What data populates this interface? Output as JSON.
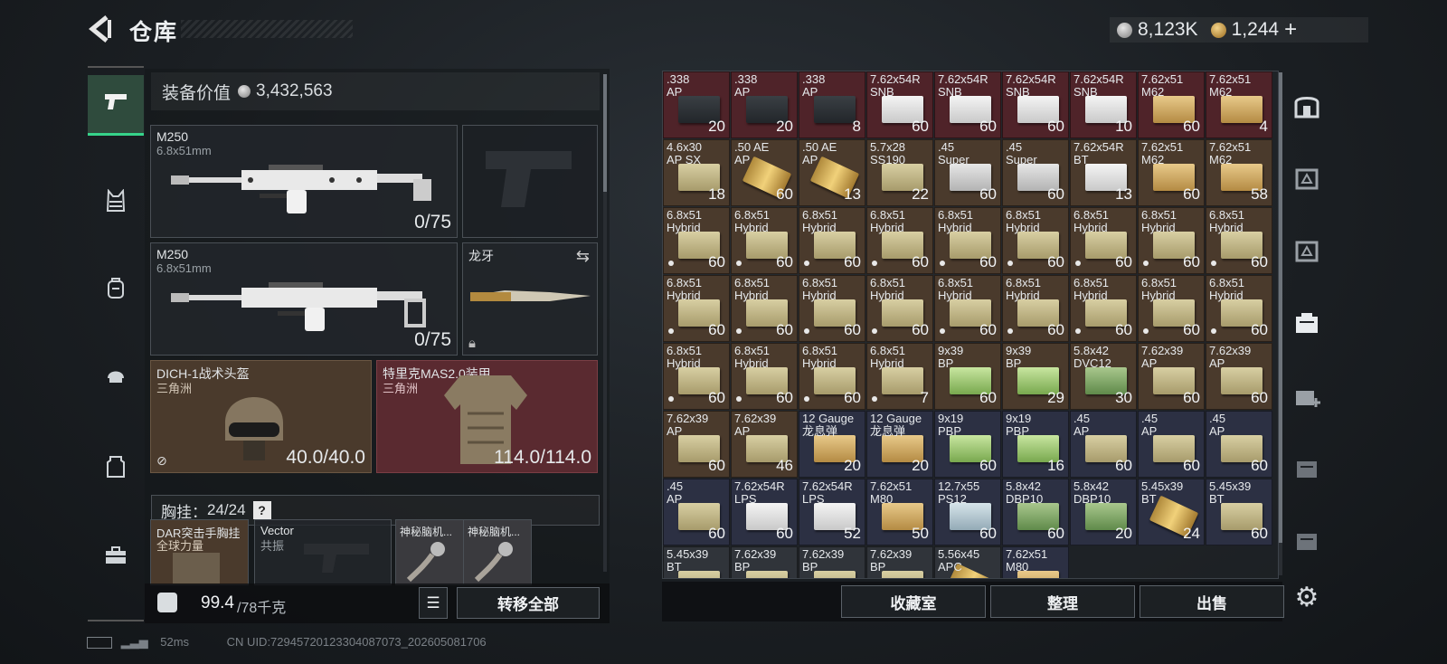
{
  "header": {
    "title": "仓库",
    "currency_silver": "8,123K",
    "currency_gold": "1,244",
    "add_symbol": "+"
  },
  "left_nav": [
    {
      "icon": "pistol-icon",
      "active": true
    },
    {
      "icon": "chest-rig-icon"
    },
    {
      "icon": "backpack-icon"
    },
    {
      "icon": "helmet-icon"
    },
    {
      "icon": "armor-plate-icon"
    },
    {
      "icon": "toolbox-icon"
    }
  ],
  "equipment": {
    "value_label": "装备价值",
    "value": "3,432,563",
    "primary": {
      "name": "M250",
      "caliber": "6.8x51mm",
      "ammo": "0/75"
    },
    "secondary": {
      "name": "M250",
      "caliber": "6.8x51mm",
      "ammo": "0/75"
    },
    "melee": {
      "name": "龙牙"
    },
    "helmet": {
      "name": "DICH-1战术头盔",
      "sub": "三角洲",
      "durability": "40.0/40.0"
    },
    "armor": {
      "name": "特里克MAS2.0装甲",
      "sub": "三角洲",
      "durability": "114.0/114.0"
    },
    "chest_rig": {
      "label": "胸挂：",
      "capacity": "24/24",
      "help": "?"
    },
    "rig_items": [
      {
        "name": "DAR突击手胸挂",
        "sub": "全球力量"
      },
      {
        "name": "Vector",
        "sub": "共振"
      },
      {
        "name": "神秘脑机..."
      },
      {
        "name": "神秘脑机..."
      }
    ],
    "weight": "99.4",
    "weight_max": "/78千克",
    "transfer_all": "转移全部"
  },
  "grid_items": [
    {
      "n": ".338",
      "s": "AP",
      "q": "20",
      "bg": "red",
      "box": "dark"
    },
    {
      "n": ".338",
      "s": "AP",
      "q": "20",
      "bg": "red",
      "box": "dark"
    },
    {
      "n": ".338",
      "s": "AP",
      "q": "8",
      "bg": "red",
      "box": "dark"
    },
    {
      "n": "7.62x54R",
      "s": "SNB",
      "q": "60",
      "bg": "red",
      "box": "white"
    },
    {
      "n": "7.62x54R",
      "s": "SNB",
      "q": "60",
      "bg": "red",
      "box": "white"
    },
    {
      "n": "7.62x54R",
      "s": "SNB",
      "q": "60",
      "bg": "red",
      "box": "white"
    },
    {
      "n": "7.62x54R",
      "s": "SNB",
      "q": "10",
      "bg": "red",
      "box": "white"
    },
    {
      "n": "7.62x51",
      "s": "M62",
      "q": "60",
      "bg": "red",
      "box": "gold"
    },
    {
      "n": "7.62x51",
      "s": "M62",
      "q": "4",
      "bg": "red",
      "box": "gold"
    },
    {
      "n": "4.6x30",
      "s": "AP SX",
      "q": "18",
      "bg": "brown",
      "box": "khaki"
    },
    {
      "n": ".50 AE",
      "s": "AP",
      "q": "60",
      "bg": "brown",
      "box": "bullet"
    },
    {
      "n": ".50 AE",
      "s": "AP",
      "q": "13",
      "bg": "brown",
      "box": "bullet"
    },
    {
      "n": "5.7x28",
      "s": "SS190",
      "q": "22",
      "bg": "brown",
      "box": "khaki"
    },
    {
      "n": ".45",
      "s": "Super",
      "q": "60",
      "bg": "brown",
      "box": "silver"
    },
    {
      "n": ".45",
      "s": "Super",
      "q": "60",
      "bg": "brown",
      "box": "silver"
    },
    {
      "n": "7.62x54R",
      "s": "BT",
      "q": "13",
      "bg": "brown",
      "box": "white"
    },
    {
      "n": "7.62x51",
      "s": "M62",
      "q": "60",
      "bg": "brown",
      "box": "gold"
    },
    {
      "n": "7.62x51",
      "s": "M62",
      "q": "58",
      "bg": "brown",
      "box": "gold"
    },
    {
      "n": "6.8x51",
      "s": "Hybrid",
      "q": "60",
      "bg": "brown",
      "box": "khaki",
      "dot": true
    },
    {
      "n": "6.8x51",
      "s": "Hybrid",
      "q": "60",
      "bg": "brown",
      "box": "khaki",
      "dot": true
    },
    {
      "n": "6.8x51",
      "s": "Hybrid",
      "q": "60",
      "bg": "brown",
      "box": "khaki",
      "dot": true
    },
    {
      "n": "6.8x51",
      "s": "Hybrid",
      "q": "60",
      "bg": "brown",
      "box": "khaki",
      "dot": true
    },
    {
      "n": "6.8x51",
      "s": "Hybrid",
      "q": "60",
      "bg": "brown",
      "box": "khaki",
      "dot": true
    },
    {
      "n": "6.8x51",
      "s": "Hybrid",
      "q": "60",
      "bg": "brown",
      "box": "khaki",
      "dot": true
    },
    {
      "n": "6.8x51",
      "s": "Hybrid",
      "q": "60",
      "bg": "brown",
      "box": "khaki",
      "dot": true
    },
    {
      "n": "6.8x51",
      "s": "Hybrid",
      "q": "60",
      "bg": "brown",
      "box": "khaki",
      "dot": true
    },
    {
      "n": "6.8x51",
      "s": "Hybrid",
      "q": "60",
      "bg": "brown",
      "box": "khaki",
      "dot": true
    },
    {
      "n": "6.8x51",
      "s": "Hybrid",
      "q": "60",
      "bg": "brown",
      "box": "khaki",
      "dot": true
    },
    {
      "n": "6.8x51",
      "s": "Hybrid",
      "q": "60",
      "bg": "brown",
      "box": "khaki",
      "dot": true
    },
    {
      "n": "6.8x51",
      "s": "Hybrid",
      "q": "60",
      "bg": "brown",
      "box": "khaki",
      "dot": true
    },
    {
      "n": "6.8x51",
      "s": "Hybrid",
      "q": "60",
      "bg": "brown",
      "box": "khaki",
      "dot": true
    },
    {
      "n": "6.8x51",
      "s": "Hybrid",
      "q": "60",
      "bg": "brown",
      "box": "khaki",
      "dot": true
    },
    {
      "n": "6.8x51",
      "s": "Hybrid",
      "q": "60",
      "bg": "brown",
      "box": "khaki",
      "dot": true
    },
    {
      "n": "6.8x51",
      "s": "Hybrid",
      "q": "60",
      "bg": "brown",
      "box": "khaki",
      "dot": true
    },
    {
      "n": "6.8x51",
      "s": "Hybrid",
      "q": "60",
      "bg": "brown",
      "box": "khaki",
      "dot": true
    },
    {
      "n": "6.8x51",
      "s": "Hybrid",
      "q": "60",
      "bg": "brown",
      "box": "khaki",
      "dot": true
    },
    {
      "n": "6.8x51",
      "s": "Hybrid",
      "q": "60",
      "bg": "brown",
      "box": "khaki",
      "dot": true
    },
    {
      "n": "6.8x51",
      "s": "Hybrid",
      "q": "60",
      "bg": "brown",
      "box": "khaki",
      "dot": true
    },
    {
      "n": "6.8x51",
      "s": "Hybrid",
      "q": "60",
      "bg": "brown",
      "box": "khaki",
      "dot": true
    },
    {
      "n": "6.8x51",
      "s": "Hybrid",
      "q": "7",
      "bg": "brown",
      "box": "khaki",
      "dot": true
    },
    {
      "n": "9x39",
      "s": "BP",
      "q": "60",
      "bg": "brown",
      "box": "green"
    },
    {
      "n": "9x39",
      "s": "BP",
      "q": "29",
      "bg": "brown",
      "box": "green"
    },
    {
      "n": "5.8x42",
      "s": "DVC12",
      "q": "30",
      "bg": "brown",
      "box": "mgreen"
    },
    {
      "n": "7.62x39",
      "s": "AP",
      "q": "60",
      "bg": "brown",
      "box": "khaki"
    },
    {
      "n": "7.62x39",
      "s": "AP",
      "q": "60",
      "bg": "brown",
      "box": "khaki"
    },
    {
      "n": "7.62x39",
      "s": "AP",
      "q": "60",
      "bg": "brown",
      "box": "khaki"
    },
    {
      "n": "7.62x39",
      "s": "AP",
      "q": "46",
      "bg": "brown",
      "box": "khaki"
    },
    {
      "n": "12 Gauge",
      "s": "龙息弹",
      "q": "20",
      "bg": "navy",
      "box": "gold"
    },
    {
      "n": "12 Gauge",
      "s": "龙息弹",
      "q": "20",
      "bg": "navy",
      "box": "gold"
    },
    {
      "n": "9x19",
      "s": "PBP",
      "q": "60",
      "bg": "navy",
      "box": "green"
    },
    {
      "n": "9x19",
      "s": "PBP",
      "q": "16",
      "bg": "navy",
      "box": "green"
    },
    {
      "n": ".45",
      "s": "AP",
      "q": "60",
      "bg": "navy",
      "box": "khaki"
    },
    {
      "n": ".45",
      "s": "AP",
      "q": "60",
      "bg": "navy",
      "box": "khaki"
    },
    {
      "n": ".45",
      "s": "AP",
      "q": "60",
      "bg": "navy",
      "box": "khaki"
    },
    {
      "n": ".45",
      "s": "AP",
      "q": "60",
      "bg": "navy",
      "box": "khaki"
    },
    {
      "n": "7.62x54R",
      "s": "LPS",
      "q": "60",
      "bg": "navy",
      "box": "white"
    },
    {
      "n": "7.62x54R",
      "s": "LPS",
      "q": "52",
      "bg": "navy",
      "box": "white"
    },
    {
      "n": "7.62x51",
      "s": "M80",
      "q": "50",
      "bg": "navy",
      "box": "gold"
    },
    {
      "n": "12.7x55",
      "s": "PS12",
      "q": "60",
      "bg": "navy",
      "box": "blue"
    },
    {
      "n": "5.8x42",
      "s": "DBP10",
      "q": "60",
      "bg": "navy",
      "box": "mgreen"
    },
    {
      "n": "5.8x42",
      "s": "DBP10",
      "q": "20",
      "bg": "navy",
      "box": "mgreen"
    },
    {
      "n": "5.45x39",
      "s": "BT",
      "q": "24",
      "bg": "navy",
      "box": "bullet"
    },
    {
      "n": "5.45x39",
      "s": "BT",
      "q": "60",
      "bg": "navy",
      "box": "khaki"
    },
    {
      "n": "5.45x39",
      "s": "BT",
      "q": "",
      "bg": "gray",
      "box": "khaki"
    },
    {
      "n": "7.62x39",
      "s": "BP",
      "q": "",
      "bg": "gray",
      "box": "khaki"
    },
    {
      "n": "7.62x39",
      "s": "BP",
      "q": "",
      "bg": "gray",
      "box": "khaki"
    },
    {
      "n": "7.62x39",
      "s": "BP",
      "q": "",
      "bg": "gray",
      "box": "khaki"
    },
    {
      "n": "5.56x45",
      "s": "APC",
      "q": "",
      "bg": "gray",
      "box": "bullet"
    },
    {
      "n": "7.62x51",
      "s": "M80",
      "q": "",
      "bg": "navy",
      "box": "gold"
    }
  ],
  "bottom_buttons": {
    "collection": "收藏室",
    "sort": "整理",
    "sell": "出售"
  },
  "right_nav": [
    {
      "icon": "safe-icon"
    },
    {
      "icon": "storage-iii-icon"
    },
    {
      "icon": "storage-iii-icon"
    },
    {
      "icon": "storage-iv-icon",
      "active": true
    },
    {
      "icon": "storage-iv-add-icon"
    },
    {
      "icon": "storage-iii-icon"
    },
    {
      "icon": "storage-iii-icon"
    }
  ],
  "status": {
    "ping": "52ms",
    "uid": "CN UID:72945720123304087073_202605081706"
  },
  "colors": {
    "accent_green": "#36d38a",
    "rare_red": "#4f2329",
    "epic_brown": "#4a3a2c",
    "blue_navy": "#2c3043"
  }
}
